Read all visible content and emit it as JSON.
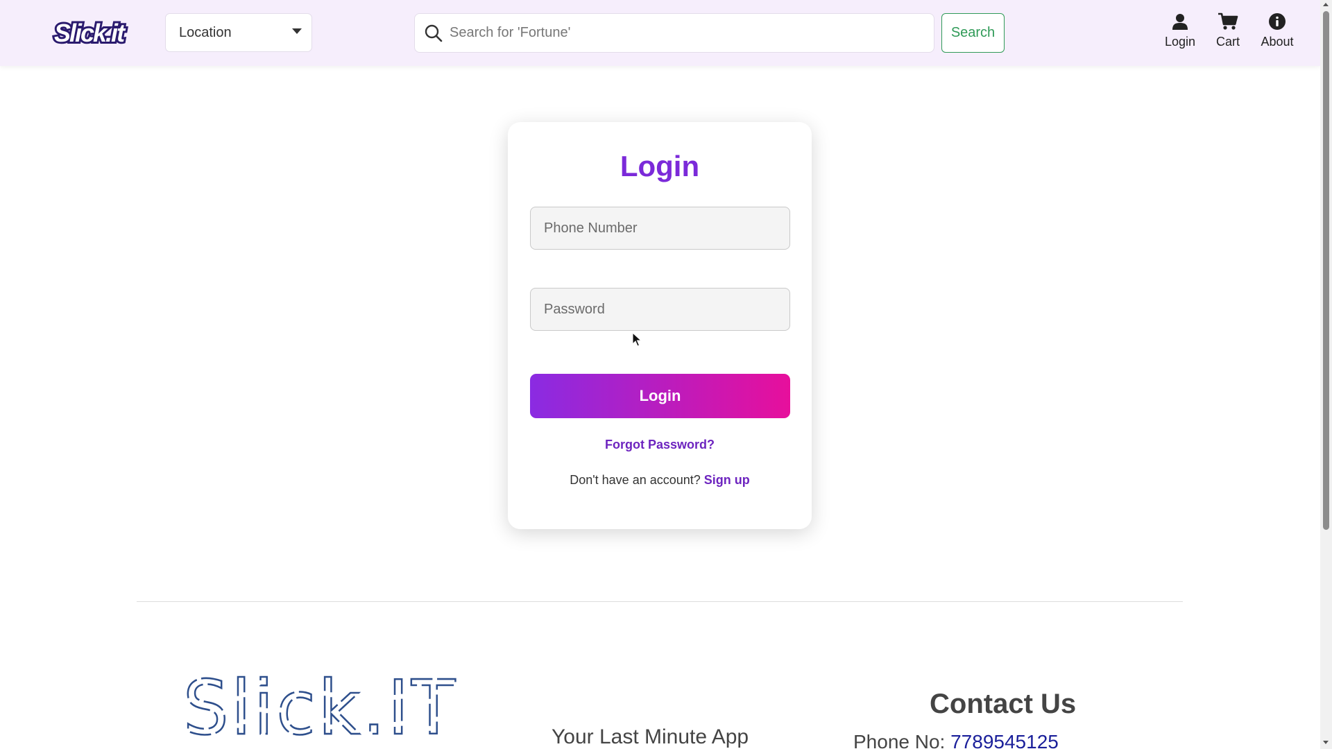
{
  "header": {
    "brand_text": "Slick.it",
    "location_label": "Location",
    "search_placeholder": "Search for 'Fortune'",
    "search_button": "Search",
    "nav": [
      {
        "label": "Login",
        "icon": "user-icon"
      },
      {
        "label": "Cart",
        "icon": "cart-icon"
      },
      {
        "label": "About",
        "icon": "info-icon"
      }
    ]
  },
  "login": {
    "title": "Login",
    "phone_placeholder": "Phone Number",
    "password_placeholder": "Password",
    "button": "Login",
    "forgot": "Forgot Password?",
    "no_account": "Don't have an account?",
    "signup": "Sign up"
  },
  "footer": {
    "logo_text": "Slick.IT",
    "tagline": "Your Last Minute App",
    "contact_title": "Contact Us",
    "phone_label": "Phone No:",
    "phone_number": "7789545125"
  },
  "colors": {
    "accent_purple": "#7b2ad9",
    "gradient_start": "#8a2be2",
    "gradient_end": "#e70f9c",
    "search_green": "#2f9a57",
    "header_bg": "#f6eefc"
  }
}
